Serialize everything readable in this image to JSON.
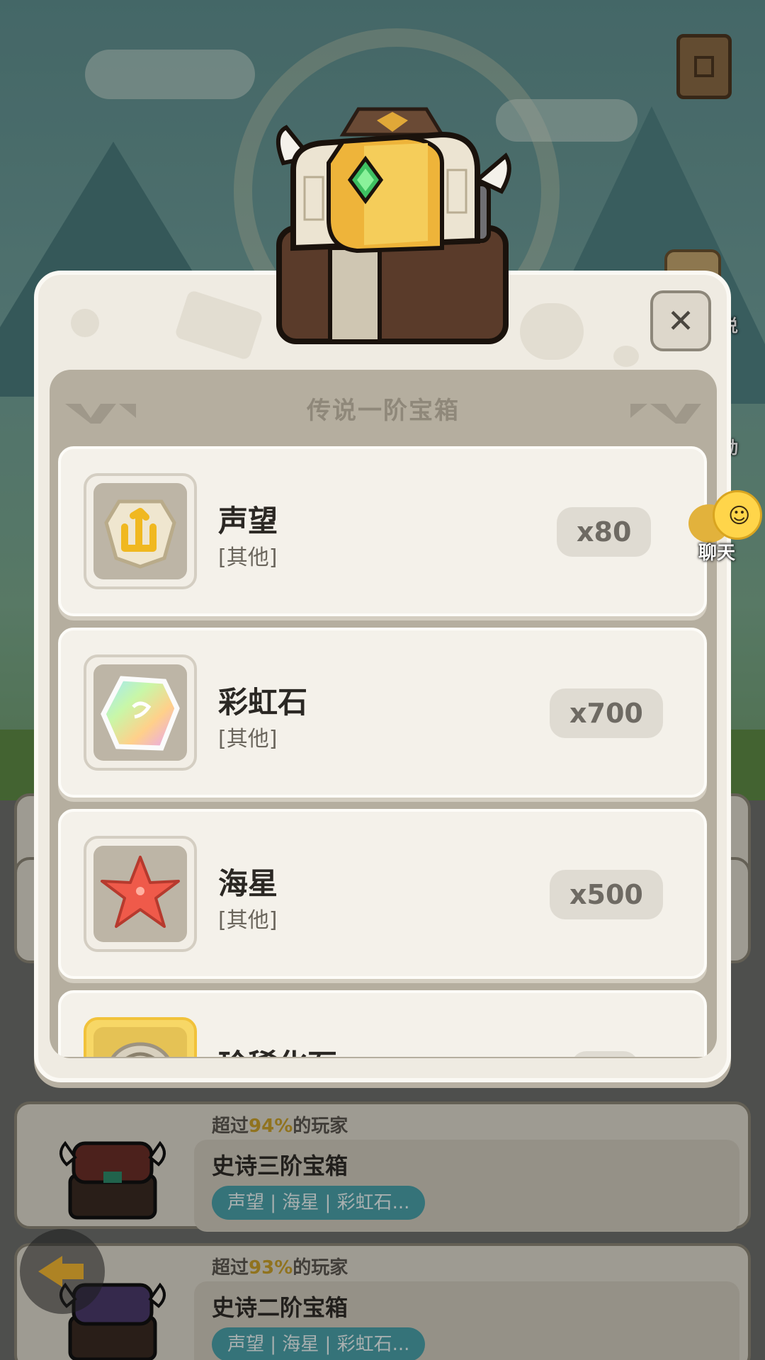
{
  "modal": {
    "title": "传说一阶宝箱",
    "close_symbol": "✕",
    "items": [
      {
        "name": "声望",
        "category": "[其他]",
        "quantity": "x80",
        "icon": "prestige-rune-icon"
      },
      {
        "name": "彩虹石",
        "category": "[其他]",
        "quantity": "x700",
        "icon": "rainbow-stone-icon"
      },
      {
        "name": "海星",
        "category": "[其他]",
        "quantity": "x500",
        "icon": "starfish-icon"
      },
      {
        "name": "珍稀化石",
        "icon": "rare-fossil-icon"
      }
    ]
  },
  "side": {
    "chat_label": "聊天",
    "partial_label_1": "说",
    "partial_label_2": "动"
  },
  "background_list": [
    {
      "percent_prefix": "超过",
      "percent_value": "94%",
      "percent_suffix": "的玩家",
      "name": "史诗三阶宝箱",
      "tags": "声望 | 海星 | 彩虹石..."
    },
    {
      "percent_prefix": "超过",
      "percent_value": "93%",
      "percent_suffix": "的玩家",
      "name": "史诗二阶宝箱",
      "tags": "声望 | 海星 | 彩虹石..."
    }
  ],
  "colors": {
    "accent_teal": "#4aa0a8",
    "highlight_gold": "#c8a02c",
    "modal_bg": "#efebe2"
  }
}
